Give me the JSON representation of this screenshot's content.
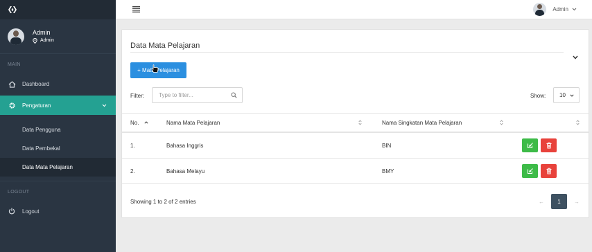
{
  "sidebar": {
    "user": {
      "name": "Admin",
      "role": "Admin"
    },
    "main_title": "MAIN",
    "items": [
      {
        "label": "Dashboard",
        "icon": "home-icon"
      },
      {
        "label": "Pengaturan",
        "icon": "gear-icon",
        "active": true
      }
    ],
    "subitems": [
      {
        "label": "Data Pengguna"
      },
      {
        "label": "Data Pembekal"
      },
      {
        "label": "Data Mata Pelajaran",
        "current": true
      }
    ],
    "logout_title": "LOGOUT",
    "logout_label": "Logout"
  },
  "topbar": {
    "user_label": "Admin"
  },
  "panel": {
    "title": "Data Mata Pelajaran",
    "add_button": "+ Mata Pelajaran",
    "filter_label": "Filter:",
    "filter_placeholder": "Type to filter...",
    "show_label": "Show:",
    "show_value": "10"
  },
  "table": {
    "headers": [
      "No.",
      "Nama Mata Pelajaran",
      "Nama Singkatan Mata Pelajaran",
      ""
    ],
    "rows": [
      {
        "no": "1.",
        "nama": "Bahasa Inggris",
        "singkatan": "BIN"
      },
      {
        "no": "2.",
        "nama": "Bahasa Melayu",
        "singkatan": "BMY"
      }
    ]
  },
  "footer": {
    "info": "Showing 1 to 2 of 2 entries",
    "prev": "←",
    "page": "1",
    "next": "→"
  },
  "colors": {
    "sidebar_bg": "#2a3542",
    "active_item": "#24a192",
    "primary_button": "#2b8fe0",
    "edit_button": "#3dbb48",
    "delete_button": "#e8423b",
    "pager_active": "#3e5161"
  }
}
